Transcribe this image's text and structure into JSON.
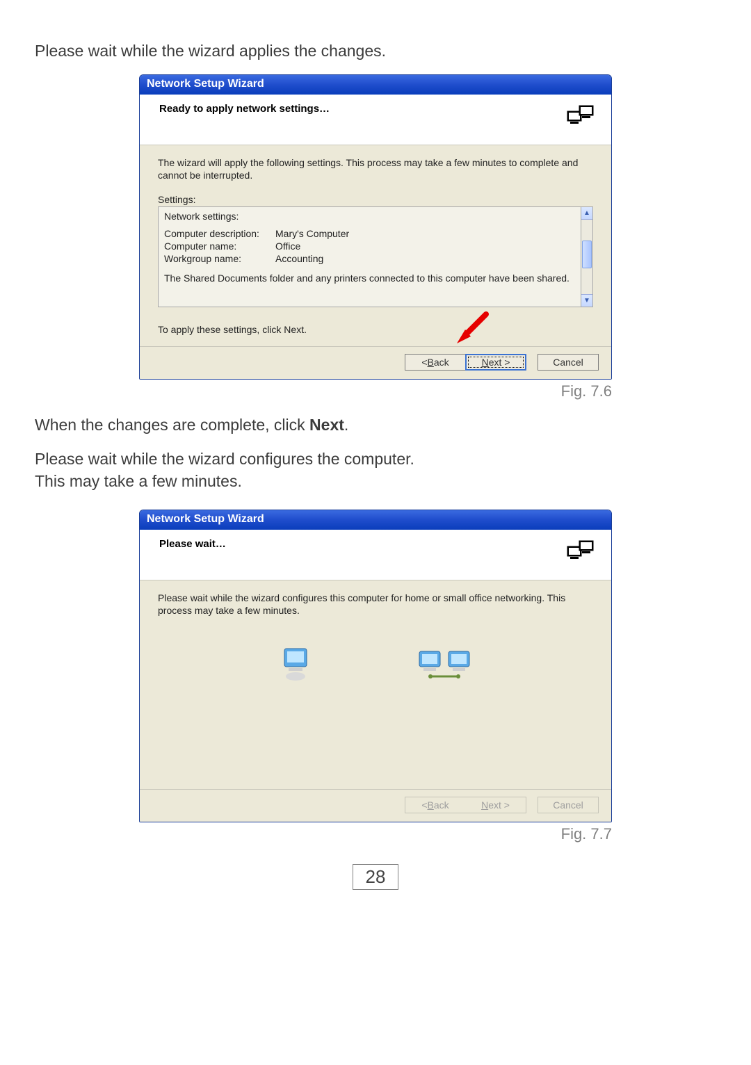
{
  "doc": {
    "intro1": "Please wait while the wizard applies the changes.",
    "after1_pre": "When the changes are complete, click ",
    "after1_bold": "Next",
    "after1_post": ".",
    "intro2a": "Please wait while the wizard configures the computer.",
    "intro2b": "This may take a few minutes.",
    "page_number": "28"
  },
  "fig1": {
    "caption": "Fig. 7.6",
    "title": "Network Setup Wizard",
    "header": "Ready to apply network settings…",
    "intro": "The wizard will apply the following settings. This process may take a few minutes to complete and cannot be interrupted.",
    "settings_label": "Settings:",
    "net_settings": "Network settings:",
    "rows": [
      {
        "key": "Computer description:",
        "val": "Mary's Computer"
      },
      {
        "key": "Computer name:",
        "val": "Office"
      },
      {
        "key": "Workgroup name:",
        "val": "Accounting"
      }
    ],
    "shared": "The Shared Documents folder and any printers connected to this computer have been shared.",
    "to_apply": "To apply these settings, click Next.",
    "buttons": {
      "back": "< Back",
      "next": "Next >",
      "cancel": "Cancel"
    }
  },
  "fig2": {
    "caption": "Fig. 7.7",
    "title": "Network Setup Wizard",
    "header": "Please wait…",
    "body": "Please wait while the wizard configures this computer for home or small office networking. This process may take a few minutes.",
    "buttons": {
      "back": "< Back",
      "next": "Next >",
      "cancel": "Cancel"
    }
  }
}
